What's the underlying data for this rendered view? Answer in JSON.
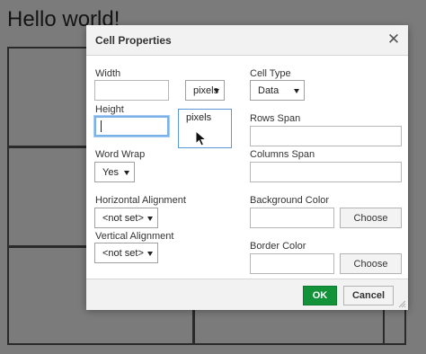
{
  "background": {
    "heading": "Hello world!"
  },
  "dialog": {
    "title": "Cell Properties",
    "close_icon": "close-icon",
    "width": {
      "label": "Width",
      "value": "",
      "unit_selected": "pixels",
      "unit_options": [
        "pixels"
      ]
    },
    "height": {
      "label": "Height",
      "value": ""
    },
    "word_wrap": {
      "label": "Word Wrap",
      "selected": "Yes"
    },
    "horizontal_alignment": {
      "label": "Horizontal Alignment",
      "selected": "<not set>"
    },
    "vertical_alignment": {
      "label": "Vertical Alignment",
      "selected": "<not set>"
    },
    "cell_type": {
      "label": "Cell Type",
      "selected": "Data"
    },
    "rows_span": {
      "label": "Rows Span",
      "value": ""
    },
    "columns_span": {
      "label": "Columns Span",
      "value": ""
    },
    "background_color": {
      "label": "Background Color",
      "value": "",
      "choose_label": "Choose"
    },
    "border_color": {
      "label": "Border Color",
      "value": "",
      "choose_label": "Choose"
    },
    "footer": {
      "ok_label": "OK",
      "cancel_label": "Cancel"
    }
  },
  "colors": {
    "overlay": "#7b7b7b",
    "ok_button": "#12933a",
    "focus_border": "#7ab2e8",
    "dropdown_border": "#5b9ad6"
  }
}
